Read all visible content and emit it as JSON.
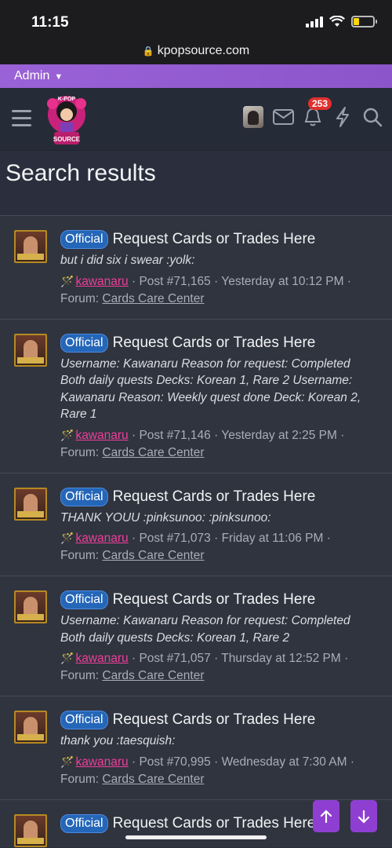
{
  "status": {
    "time": "11:15"
  },
  "url": {
    "domain": "kpopsource.com"
  },
  "admin": {
    "label": "Admin"
  },
  "header": {
    "logo_text_top": "K-POP",
    "logo_text_bottom": "SOURCE",
    "alerts_count": "253"
  },
  "page": {
    "title": "Search results"
  },
  "results": [
    {
      "tag": "Official",
      "title": "Request Cards or Trades Here",
      "snippet": "but i did six i swear :yolk:",
      "user": "kawanaru",
      "post": "Post #71,165",
      "date": "Yesterday at 10:12 PM",
      "forum_label": "Forum:",
      "forum": "Cards Care Center"
    },
    {
      "tag": "Official",
      "title": "Request Cards or Trades Here",
      "snippet": "Username: Kawanaru Reason for request: Completed Both daily quests Decks: Korean 1, Rare 2 Username: Kawanaru Reason: Weekly quest done Deck: Korean 2, Rare 1",
      "user": "kawanaru",
      "post": "Post #71,146",
      "date": "Yesterday at 2:25 PM",
      "forum_label": "Forum:",
      "forum": "Cards Care Center"
    },
    {
      "tag": "Official",
      "title": "Request Cards or Trades Here",
      "snippet": "THANK YOUU :pinksunoo: :pinksunoo:",
      "user": "kawanaru",
      "post": "Post #71,073",
      "date": "Friday at 11:06 PM",
      "forum_label": "Forum:",
      "forum": "Cards Care Center"
    },
    {
      "tag": "Official",
      "title": "Request Cards or Trades Here",
      "snippet": "Username: Kawanaru Reason for request: Completed Both daily quests Decks: Korean 1, Rare 2",
      "user": "kawanaru",
      "post": "Post #71,057",
      "date": "Thursday at 12:52 PM",
      "forum_label": "Forum:",
      "forum": "Cards Care Center"
    },
    {
      "tag": "Official",
      "title": "Request Cards or Trades Here",
      "snippet": "thank you :taesquish:",
      "user": "kawanaru",
      "post": "Post #70,995",
      "date": "Wednesday at 7:30 AM",
      "forum_label": "Forum:",
      "forum": "Cards Care Center"
    },
    {
      "tag": "Official",
      "title": "Request Cards or Trades Here",
      "snippet": "",
      "user": "",
      "post": "",
      "date": "",
      "forum_label": "",
      "forum": ""
    }
  ],
  "colors": {
    "accent": "#8e3fd1",
    "tag": "#2466b8",
    "username": "#ee3f9a",
    "admin_bar": "#9a62d6"
  },
  "icons": [
    "hamburger-icon",
    "envelope-icon",
    "bell-icon",
    "lightning-icon",
    "search-icon",
    "arrow-up-icon",
    "arrow-down-icon",
    "wand-icon",
    "lock-icon"
  ]
}
